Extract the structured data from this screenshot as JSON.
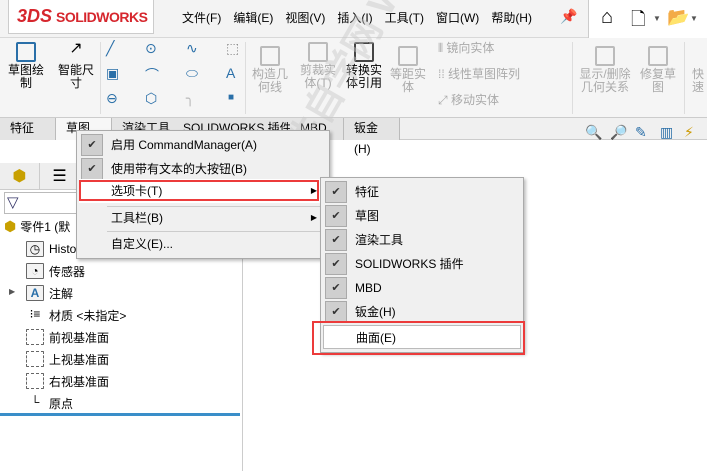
{
  "app": {
    "brand": "SOLIDWORKS",
    "logo_mark": "3DS"
  },
  "menubar": [
    "文件(F)",
    "编辑(E)",
    "视图(V)",
    "插入(I)",
    "工具(T)",
    "窗口(W)",
    "帮助(H)"
  ],
  "ribbon": {
    "sketch": "草图绘\n制",
    "smart_dim": "智能尺\n寸",
    "construct": "构造几\n何线",
    "trim": "剪裁实\n体(T)",
    "convert": "转换实\n体引用",
    "offset": "等距实\n体",
    "mirror": "镜向实体",
    "linear_pattern": "线性草图阵列",
    "move": "移动实体",
    "show_delete": "显示/删除\n几何关系",
    "repair": "修复草\n图",
    "quick": "快速"
  },
  "tabs": [
    "特征",
    "草图",
    "渲染工具",
    "SOLIDWORKS 插件",
    "MBD",
    "钣金(H)"
  ],
  "tree": {
    "root": "零件1 (默",
    "items": [
      "History",
      "传感器",
      "注解",
      "材质 <未指定>",
      "前视基准面",
      "上视基准面",
      "右视基准面",
      "原点"
    ]
  },
  "context_menu": [
    {
      "label": "启用 CommandManager(A)",
      "checked": true
    },
    {
      "label": "使用带有文本的大按钮(B)",
      "checked": true
    },
    {
      "label": "选项卡(T)",
      "submenu": true,
      "highlighted": true
    },
    {
      "label": "工具栏(B)",
      "submenu": true
    },
    {
      "label": "自定义(E)..."
    }
  ],
  "submenu": [
    {
      "label": "特征",
      "checked": true
    },
    {
      "label": "草图",
      "checked": true
    },
    {
      "label": "渲染工具",
      "checked": true
    },
    {
      "label": "SOLIDWORKS 插件",
      "checked": true
    },
    {
      "label": "MBD",
      "checked": true
    },
    {
      "label": "钣金(H)",
      "checked": true
    },
    {
      "label": "曲面(E)",
      "checked": false,
      "highlighted": true
    }
  ],
  "watermark": "软件自学网 WWW.RJZXW.COM",
  "colors": {
    "highlight": "#ec3b3b",
    "brand": "#d6262d",
    "accent": "#3a8ec9"
  }
}
